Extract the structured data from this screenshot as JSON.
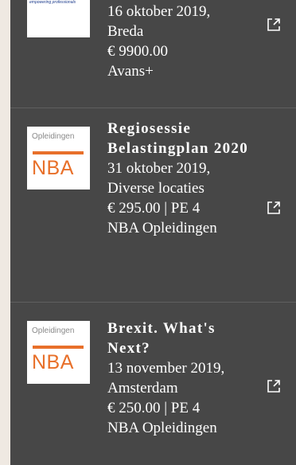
{
  "items": [
    {
      "logo": {
        "icon": "avans-plus-logo",
        "tagline": "empowering professionals"
      },
      "title": "",
      "date_location": "16 oktober 2019, Breda",
      "price": "€ 9900.00",
      "provider": "Avans+",
      "link_icon": "external-link-icon"
    },
    {
      "logo": {
        "icon": "nba-logo",
        "small": "Opleidingen",
        "big": "NBA"
      },
      "title": "Regiosessie Belastingplan 2020",
      "date_location": "31 oktober 2019, Diverse locaties",
      "price": "€ 295.00 | PE 4",
      "provider": "NBA Opleidingen",
      "link_icon": "external-link-icon"
    },
    {
      "logo": {
        "icon": "nba-logo",
        "small": "Opleidingen",
        "big": "NBA"
      },
      "title": "Brexit. What's Next?",
      "date_location": "13 november 2019, Amsterdam",
      "price": "€ 250.00 | PE 4",
      "provider": "NBA Opleidingen",
      "link_icon": "external-link-icon"
    }
  ],
  "colors": {
    "page_background": "#efe9e2",
    "panel_background": "#474747",
    "text": "#ffffff",
    "nba_orange": "#e8702a"
  }
}
